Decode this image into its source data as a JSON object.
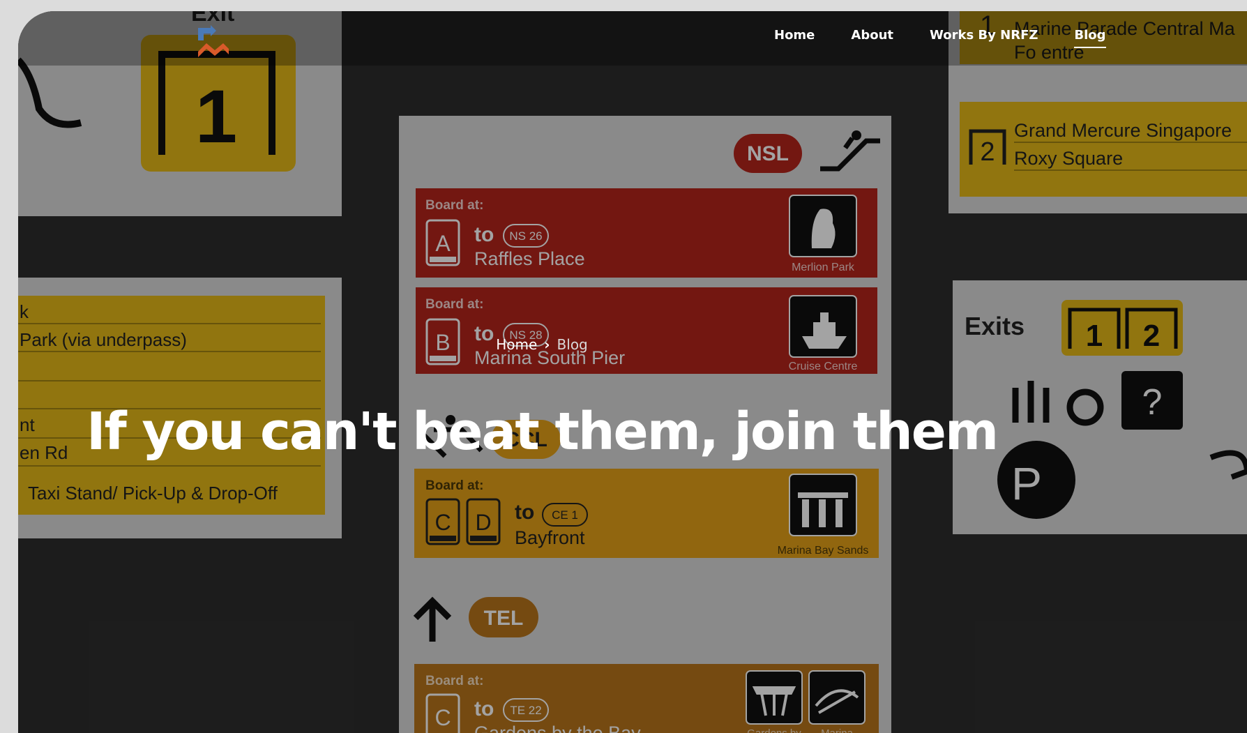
{
  "nav": {
    "items": [
      {
        "label": "Home"
      },
      {
        "label": "About"
      },
      {
        "label": "Works By NRFZ"
      },
      {
        "label": "Blog"
      }
    ]
  },
  "breadcrumb": {
    "home": "Home",
    "current": "Blog"
  },
  "hero": {
    "title": "If you can't beat them, join them"
  },
  "colors": {
    "accent_red": "#6b1511",
    "accent_yellow": "#bfa01c",
    "accent_orange": "#7a4a12"
  },
  "background_sign": {
    "top_left_exit": {
      "label": "Exit",
      "number": "1"
    },
    "top_right": [
      {
        "number": "1",
        "lines": [
          "Marine Parade Central Ma",
          "Fo    entre"
        ]
      },
      {
        "number": "2",
        "lines": [
          "Grand Mercure Singapore",
          "Roxy Square"
        ]
      }
    ],
    "left_list": [
      "k",
      "Park (via underpass)",
      "nt",
      "en Rd",
      "Taxi Stand/ Pick-Up & Drop-Off"
    ],
    "center": {
      "line_nsl": "NSL",
      "line_ccl": "CCL",
      "line_tel": "TEL",
      "boards": [
        {
          "board_at": "Board at:",
          "exits": [
            "A"
          ],
          "to": "to",
          "code": "NS 26",
          "destination": "Raffles Place",
          "icon_label": "Merlion Park"
        },
        {
          "board_at": "Board at:",
          "exits": [
            "B"
          ],
          "to": "to",
          "code": "NS 28",
          "destination": "Marina South Pier",
          "icon_label": "Cruise Centre"
        },
        {
          "board_at": "Board at:",
          "exits": [
            "C",
            "D"
          ],
          "to": "to",
          "code": "CE 1",
          "destination": "Bayfront",
          "icon_label": "Marina Bay Sands"
        },
        {
          "board_at": "Board at:",
          "exits": [
            "C"
          ],
          "to": "to",
          "code": "TE 22",
          "destination": "Gardens by the Bay",
          "icon_label_1": "Gardens by",
          "icon_label_2": "Marina"
        }
      ]
    },
    "right_exits": {
      "label": "Exits",
      "numbers": [
        "1",
        "2"
      ]
    },
    "parking": "P"
  }
}
